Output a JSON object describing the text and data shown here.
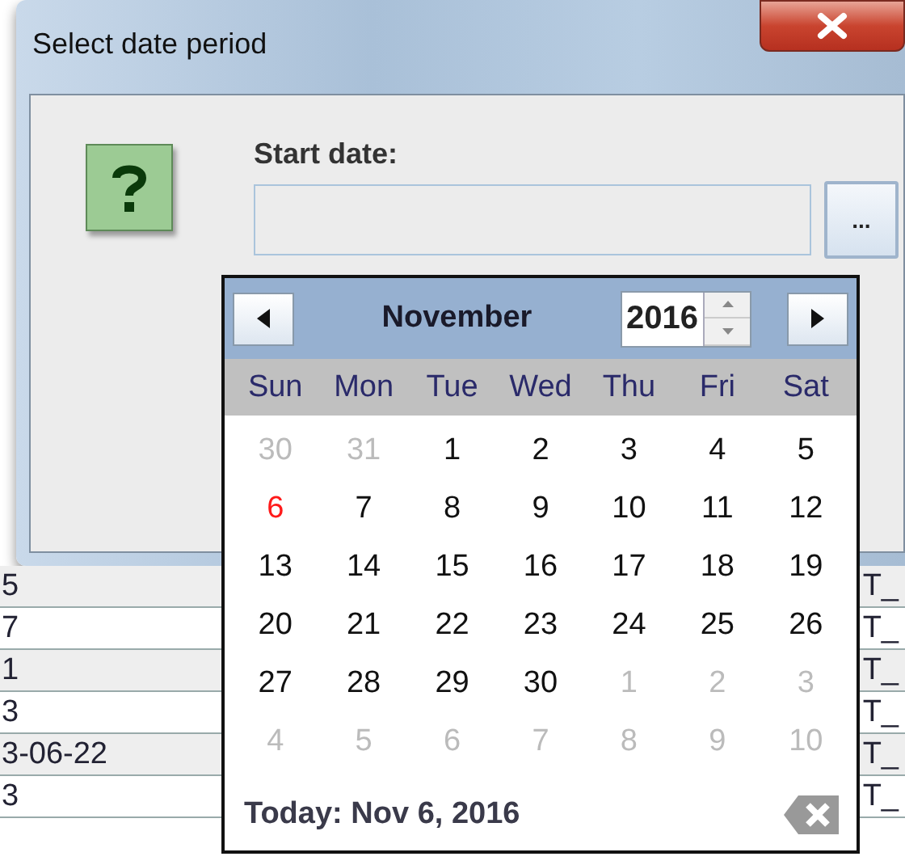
{
  "window": {
    "title": "Select date period"
  },
  "dialog": {
    "label": "Start date:",
    "browse_button": "..."
  },
  "calendar": {
    "month": "November",
    "year": "2016",
    "weekdays": [
      "Sun",
      "Mon",
      "Tue",
      "Wed",
      "Thu",
      "Fri",
      "Sat"
    ],
    "weeks": [
      [
        {
          "day": "30",
          "in_month": false,
          "today": false
        },
        {
          "day": "31",
          "in_month": false,
          "today": false
        },
        {
          "day": "1",
          "in_month": true,
          "today": false
        },
        {
          "day": "2",
          "in_month": true,
          "today": false
        },
        {
          "day": "3",
          "in_month": true,
          "today": false
        },
        {
          "day": "4",
          "in_month": true,
          "today": false
        },
        {
          "day": "5",
          "in_month": true,
          "today": false
        }
      ],
      [
        {
          "day": "6",
          "in_month": true,
          "today": true
        },
        {
          "day": "7",
          "in_month": true,
          "today": false
        },
        {
          "day": "8",
          "in_month": true,
          "today": false
        },
        {
          "day": "9",
          "in_month": true,
          "today": false
        },
        {
          "day": "10",
          "in_month": true,
          "today": false
        },
        {
          "day": "11",
          "in_month": true,
          "today": false
        },
        {
          "day": "12",
          "in_month": true,
          "today": false
        }
      ],
      [
        {
          "day": "13",
          "in_month": true,
          "today": false
        },
        {
          "day": "14",
          "in_month": true,
          "today": false
        },
        {
          "day": "15",
          "in_month": true,
          "today": false
        },
        {
          "day": "16",
          "in_month": true,
          "today": false
        },
        {
          "day": "17",
          "in_month": true,
          "today": false
        },
        {
          "day": "18",
          "in_month": true,
          "today": false
        },
        {
          "day": "19",
          "in_month": true,
          "today": false
        }
      ],
      [
        {
          "day": "20",
          "in_month": true,
          "today": false
        },
        {
          "day": "21",
          "in_month": true,
          "today": false
        },
        {
          "day": "22",
          "in_month": true,
          "today": false
        },
        {
          "day": "23",
          "in_month": true,
          "today": false
        },
        {
          "day": "24",
          "in_month": true,
          "today": false
        },
        {
          "day": "25",
          "in_month": true,
          "today": false
        },
        {
          "day": "26",
          "in_month": true,
          "today": false
        }
      ],
      [
        {
          "day": "27",
          "in_month": true,
          "today": false
        },
        {
          "day": "28",
          "in_month": true,
          "today": false
        },
        {
          "day": "29",
          "in_month": true,
          "today": false
        },
        {
          "day": "30",
          "in_month": true,
          "today": false
        },
        {
          "day": "1",
          "in_month": false,
          "today": false
        },
        {
          "day": "2",
          "in_month": false,
          "today": false
        },
        {
          "day": "3",
          "in_month": false,
          "today": false
        }
      ],
      [
        {
          "day": "4",
          "in_month": false,
          "today": false
        },
        {
          "day": "5",
          "in_month": false,
          "today": false
        },
        {
          "day": "6",
          "in_month": false,
          "today": false
        },
        {
          "day": "7",
          "in_month": false,
          "today": false
        },
        {
          "day": "8",
          "in_month": false,
          "today": false
        },
        {
          "day": "9",
          "in_month": false,
          "today": false
        },
        {
          "day": "10",
          "in_month": false,
          "today": false
        }
      ]
    ],
    "footer": "Today: Nov 6, 2016"
  },
  "table": {
    "rows": [
      {
        "column_1": "5",
        "column_2": "T_"
      },
      {
        "column_1": "7",
        "column_2": "T_"
      },
      {
        "column_1": "1",
        "column_2": "T_"
      },
      {
        "column_1": "3",
        "column_2": "T_"
      },
      {
        "column_1": "3-06-22",
        "column_2": "T_"
      },
      {
        "column_1": "3",
        "column_2": "T_"
      }
    ]
  }
}
